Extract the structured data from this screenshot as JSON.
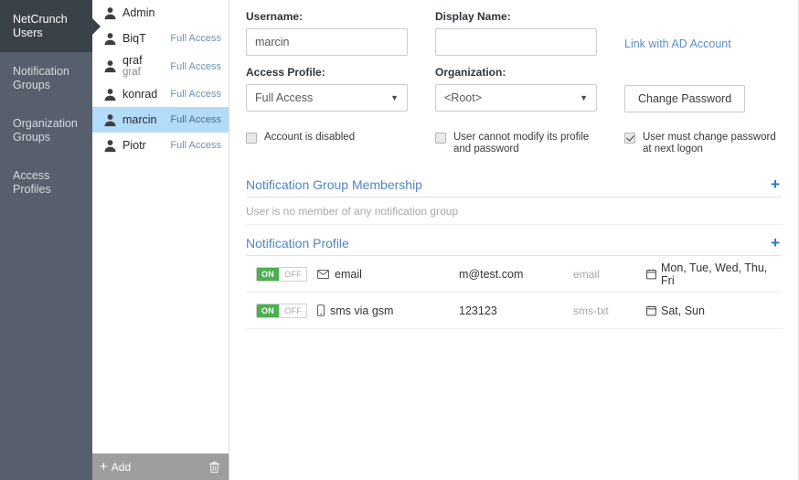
{
  "nav": {
    "items": [
      {
        "label": "NetCrunch Users",
        "lines": [
          "NetCrunch",
          "Users"
        ],
        "selected": true
      },
      {
        "label": "Notification Groups",
        "lines": [
          "Notification",
          "Groups"
        ],
        "selected": false
      },
      {
        "label": "Organization Groups",
        "lines": [
          "Organization",
          "Groups"
        ],
        "selected": false
      },
      {
        "label": "Access Profiles",
        "lines": [
          "Access",
          "Profiles"
        ],
        "selected": false
      }
    ]
  },
  "user_list": {
    "items": [
      {
        "name": "Admin",
        "sub": "",
        "access": "",
        "selected": false
      },
      {
        "name": "BiqT",
        "sub": "",
        "access": "Full Access",
        "selected": false
      },
      {
        "name": "qraf",
        "sub": "graf",
        "access": "Full Access",
        "selected": false
      },
      {
        "name": "konrad",
        "sub": "",
        "access": "Full Access",
        "selected": false
      },
      {
        "name": "marcin",
        "sub": "",
        "access": "Full Access",
        "selected": true
      },
      {
        "name": "Piotr",
        "sub": "",
        "access": "Full Access",
        "selected": false
      }
    ],
    "footer": {
      "add_label": "Add",
      "delete_icon": "trash-icon"
    }
  },
  "form": {
    "username": {
      "label": "Username:",
      "value": "marcin",
      "placeholder": ""
    },
    "display_name": {
      "label": "Display Name:",
      "value": "",
      "placeholder": ""
    },
    "link_ad": "Link with AD Account",
    "access_profile": {
      "label": "Access Profile:",
      "value": "Full Access"
    },
    "organization": {
      "label": "Organization:",
      "value": "<Root>"
    },
    "change_password": "Change Password",
    "checkboxes": [
      {
        "label": "Account is disabled",
        "checked": false
      },
      {
        "label": "User cannot modify its profile and password",
        "checked": false
      },
      {
        "label": "User must change password at next logon",
        "checked": true
      }
    ]
  },
  "sections": {
    "group_membership": {
      "title": "Notification Group Membership",
      "add_icon": "plus-icon",
      "empty_text": "User is no member of any notification group"
    },
    "notification_profile": {
      "title": "Notification Profile",
      "add_icon": "plus-icon",
      "toggle": {
        "on": "ON",
        "off": "OFF"
      },
      "rows": [
        {
          "enabled": true,
          "icon": "envelope-icon",
          "channel": "email",
          "target": "m@test.com",
          "format": "email",
          "days": "Mon, Tue, Wed, Thu, Fri"
        },
        {
          "enabled": true,
          "icon": "phone-icon",
          "channel": "sms via gsm",
          "target": "123123",
          "format": "sms-txt",
          "days": "Sat, Sun"
        }
      ]
    }
  },
  "colors": {
    "nav_bg": "#565f6b",
    "nav_selected_bg": "#3b4149",
    "row_selected_bg": "#b3dcfa",
    "link_blue": "#5b8fc9",
    "section_blue": "#4f86c6",
    "toggle_on_green": "#4caf50",
    "footer_gray": "#9e9e9e"
  }
}
